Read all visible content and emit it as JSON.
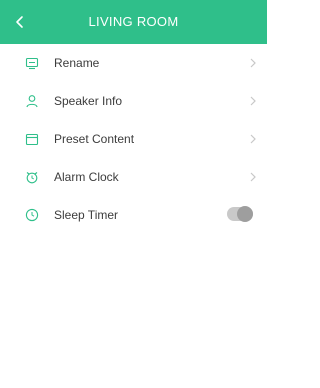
{
  "header": {
    "title": "LIVING ROOM",
    "back_icon": "chevron-left-icon",
    "background_color": "#2fbf8a"
  },
  "menu": {
    "items": [
      {
        "label": "Rename",
        "icon": "rename-icon"
      },
      {
        "label": "Speaker Info",
        "icon": "person-icon"
      },
      {
        "label": "Preset Content",
        "icon": "folder-icon"
      },
      {
        "label": "Alarm Clock",
        "icon": "alarm-clock-icon"
      }
    ],
    "sleep_timer": {
      "label": "Sleep Timer",
      "icon": "timer-icon",
      "enabled": false
    }
  },
  "colors": {
    "accent": "#2fbf8a",
    "text": "#3c3c3c",
    "chevron": "#c8c8c8"
  }
}
